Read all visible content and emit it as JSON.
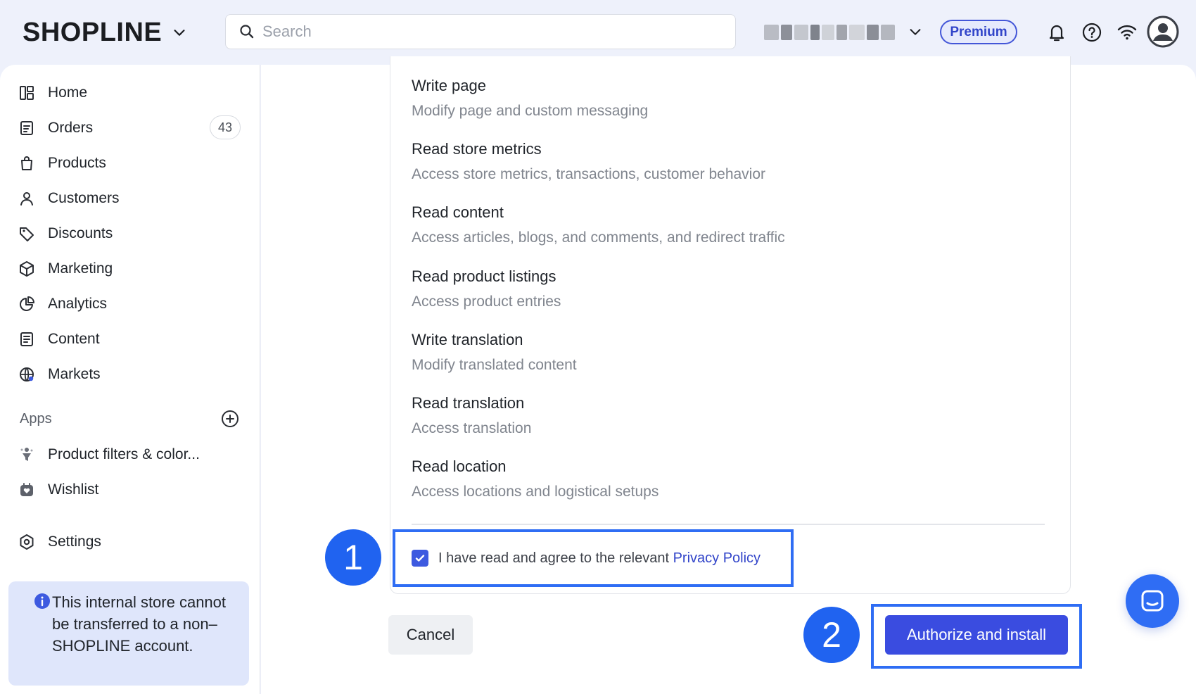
{
  "header": {
    "logo_text": "SHOPLINE",
    "search_placeholder": "Search",
    "plan_badge": "Premium"
  },
  "sidebar": {
    "items": [
      {
        "label": "Home",
        "icon": "dashboard-icon"
      },
      {
        "label": "Orders",
        "icon": "orders-icon",
        "count": "43"
      },
      {
        "label": "Products",
        "icon": "shopping-bag-icon"
      },
      {
        "label": "Customers",
        "icon": "person-icon"
      },
      {
        "label": "Discounts",
        "icon": "tag-icon"
      },
      {
        "label": "Marketing",
        "icon": "cube-icon"
      },
      {
        "label": "Analytics",
        "icon": "pie-chart-icon"
      },
      {
        "label": "Content",
        "icon": "document-icon"
      },
      {
        "label": "Markets",
        "icon": "globe-icon"
      }
    ],
    "apps_heading": "Apps",
    "apps": [
      {
        "label": "Product filters & color...",
        "icon": "filter-app-icon"
      },
      {
        "label": "Wishlist",
        "icon": "wishlist-app-icon"
      }
    ],
    "settings_label": "Settings",
    "notice": "This internal store cannot be transferred to a non–SHOPLINE account."
  },
  "permissions": [
    {
      "title": "Write page",
      "description": "Modify page and custom messaging"
    },
    {
      "title": "Read store metrics",
      "description": "Access store metrics, transactions, customer behavior"
    },
    {
      "title": "Read content",
      "description": "Access articles, blogs, and comments, and redirect traffic"
    },
    {
      "title": "Read product listings",
      "description": "Access product entries"
    },
    {
      "title": "Write translation",
      "description": "Modify translated content"
    },
    {
      "title": "Read translation",
      "description": "Access translation"
    },
    {
      "title": "Read location",
      "description": "Access locations and logistical setups"
    }
  ],
  "agreement": {
    "text": "I have read and agree to the relevant",
    "link": "Privacy Policy",
    "checked": true
  },
  "actions": {
    "cancel_label": "Cancel",
    "authorize_label": "Authorize and install"
  },
  "annotations": {
    "step1": "1",
    "step2": "2"
  },
  "colors": {
    "accent": "#3a4ce0",
    "annotation": "#2063f0",
    "notice_bg": "#dfe6fb"
  }
}
